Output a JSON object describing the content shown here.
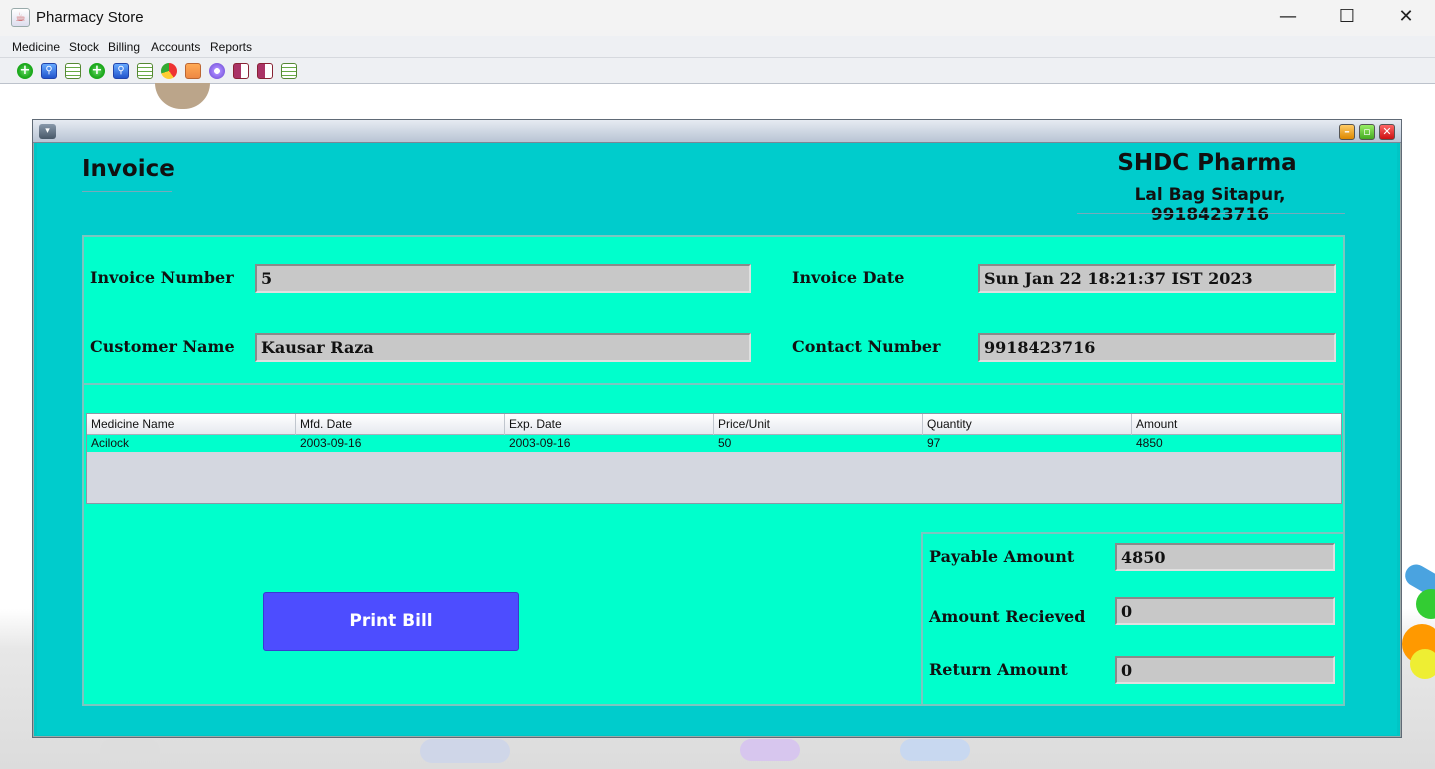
{
  "window": {
    "title": "Pharmacy Store",
    "minimize": "—",
    "maximize": "☐",
    "close": "✕"
  },
  "menu": [
    "Medicine",
    "Stock",
    "Billing",
    "Accounts",
    "Reports"
  ],
  "toolbar_icons": [
    "add-icon",
    "search-icon",
    "grid-icon",
    "add-icon",
    "search-icon",
    "grid-icon",
    "pie-chart-icon",
    "chart-icon",
    "purple-icon",
    "book-icon",
    "book-icon",
    "grid-icon"
  ],
  "internal_frame": {
    "title_menu": "▾",
    "buttons": {
      "minimize": "–",
      "maximize": "▫",
      "close": "✕"
    }
  },
  "invoice": {
    "title": "Invoice",
    "shop_name": "SHDC Pharma",
    "shop_address": "Lal Bag Sitapur, 9918423716",
    "fields": {
      "invoice_number_label": "Invoice Number",
      "invoice_number": "5",
      "invoice_date_label": "Invoice Date",
      "invoice_date": "Sun Jan 22 18:21:37 IST 2023",
      "customer_name_label": "Customer Name",
      "customer_name": "Kausar Raza",
      "contact_number_label": "Contact Number",
      "contact_number": "9918423716"
    },
    "table": {
      "columns": [
        "Medicine Name",
        "Mfd. Date",
        "Exp. Date",
        "Price/Unit",
        "Quantity",
        "Amount"
      ],
      "rows": [
        [
          "Acilock",
          "2003-09-16",
          "2003-09-16",
          "50",
          "97",
          "4850"
        ]
      ]
    },
    "print_label": "Print Bill",
    "amounts": {
      "payable_label": "Payable Amount",
      "payable": "4850",
      "received_label": "Amount Recieved",
      "received": "0",
      "return_label": "Return Amount",
      "return": "0"
    }
  },
  "colors": {
    "panel": "#00ffcc",
    "frame": "#00cccc",
    "button": "#4d4dff"
  }
}
